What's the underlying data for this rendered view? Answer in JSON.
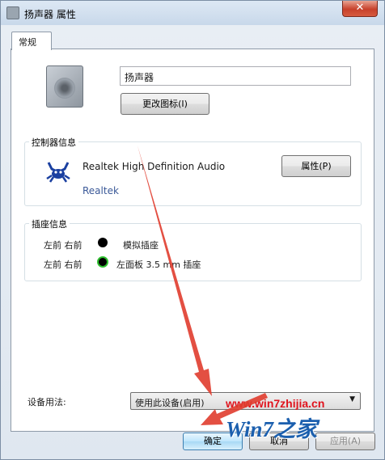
{
  "window": {
    "title": "扬声器 属性",
    "close_label": "✕"
  },
  "tabs": [
    {
      "label": "常规"
    }
  ],
  "general": {
    "device_name_value": "扬声器",
    "change_icon_button": "更改图标(I)"
  },
  "controller": {
    "group_label": "控制器信息",
    "name": "Realtek High Definition Audio",
    "vendor": "Realtek",
    "properties_button": "属性(P)"
  },
  "jack": {
    "group_label": "插座信息",
    "rows": [
      {
        "channels": "左前 右前",
        "description": "模拟插座",
        "color": "#000000"
      },
      {
        "channels": "左前 右前",
        "description": "左面板 3.5 mm 插座",
        "color": "#000000"
      }
    ]
  },
  "usage": {
    "label": "设备用法:",
    "selected": "使用此设备(启用)"
  },
  "buttons": {
    "ok": "确定",
    "cancel": "取消",
    "apply": "应用(A)"
  },
  "watermark": {
    "url": "www.win7zhijia.cn",
    "logo": "Win7之家"
  },
  "colors": {
    "annotation_arrow": "#e03c2e",
    "watermark_red": "#e0141e",
    "watermark_blue": "#1b5fae",
    "jack_ring_green": "#2fbf2f"
  }
}
